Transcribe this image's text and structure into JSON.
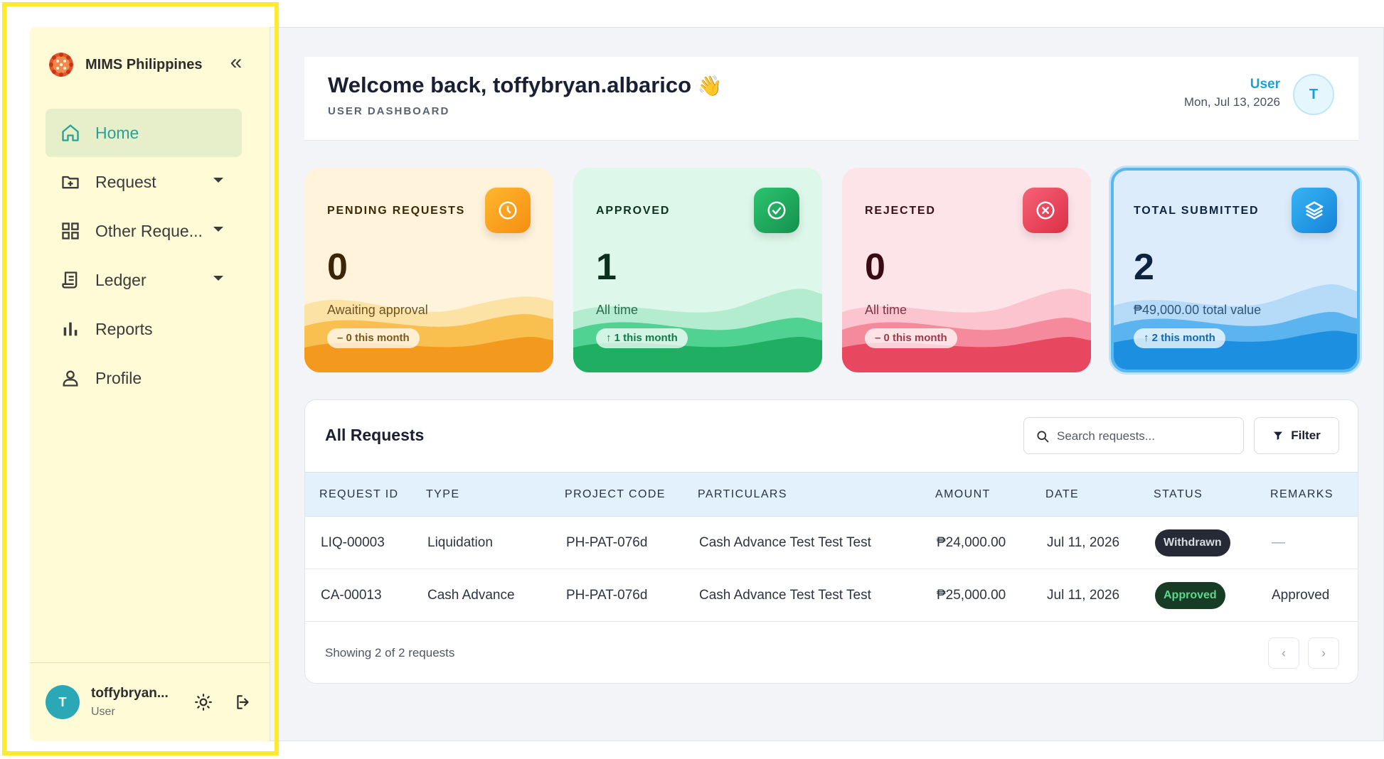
{
  "sidebar": {
    "brand": "MIMS Philippines",
    "items": [
      {
        "label": "Home"
      },
      {
        "label": "Request"
      },
      {
        "label": "Other Reque..."
      },
      {
        "label": "Ledger"
      },
      {
        "label": "Reports"
      },
      {
        "label": "Profile"
      }
    ],
    "user": {
      "initial": "T",
      "name": "toffybryan...",
      "role": "User"
    }
  },
  "header": {
    "welcome": "Welcome back, toffybryan.albarico",
    "wave": "👋",
    "subtitle": "USER DASHBOARD",
    "role": "User",
    "date": "Mon, Jul 13, 2026",
    "initial": "T"
  },
  "stats": [
    {
      "title": "PENDING REQUESTS",
      "value": "0",
      "sub": "Awaiting approval",
      "pill": "– 0 this month"
    },
    {
      "title": "APPROVED",
      "value": "1",
      "sub": "All time",
      "pill": "↑ 1 this month"
    },
    {
      "title": "REJECTED",
      "value": "0",
      "sub": "All time",
      "pill": "– 0 this month"
    },
    {
      "title": "TOTAL SUBMITTED",
      "value": "2",
      "sub": "₱49,000.00 total value",
      "pill": "↑ 2 this month"
    }
  ],
  "requests": {
    "title": "All Requests",
    "search_placeholder": "Search requests...",
    "filter_label": "Filter",
    "columns": [
      "REQUEST ID",
      "TYPE",
      "PROJECT CODE",
      "PARTICULARS",
      "AMOUNT",
      "DATE",
      "STATUS",
      "REMARKS"
    ],
    "rows": [
      {
        "id": "LIQ-00003",
        "type": "Liquidation",
        "project": "PH-PAT-076d",
        "particulars": "Cash Advance Test Test Test",
        "amount": "₱24,000.00",
        "date": "Jul 11, 2026",
        "status": "Withdrawn",
        "remarks": "—"
      },
      {
        "id": "CA-00013",
        "type": "Cash Advance",
        "project": "PH-PAT-076d",
        "particulars": "Cash Advance Test Test Test",
        "amount": "₱25,000.00",
        "date": "Jul 11, 2026",
        "status": "Approved",
        "remarks": "Approved"
      }
    ],
    "footer": "Showing 2 of 2 requests",
    "prev": "‹",
    "next": "›"
  },
  "colors": {
    "accent": "#2aa197",
    "sidebar_bg": "#fffbd6",
    "pending": "#f39a1e",
    "approved": "#1fae62",
    "rejected": "#e8485f",
    "total": "#1d8fe0"
  }
}
